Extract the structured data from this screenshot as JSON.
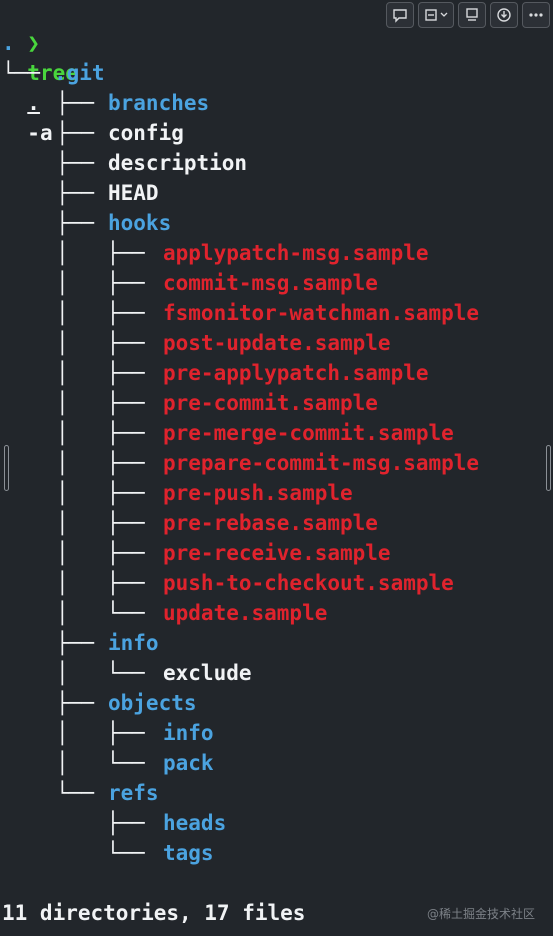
{
  "prompt": {
    "chevron": "❯",
    "command": "tree",
    "args_dot": ".",
    "args_flag": "-a"
  },
  "toolbar": {
    "buttons": [
      {
        "icon": "comment-icon"
      },
      {
        "icon": "align-icon",
        "has_dropdown": true
      },
      {
        "icon": "monitor-icon"
      },
      {
        "icon": "download-icon"
      },
      {
        "icon": "more-icon"
      }
    ]
  },
  "tree": {
    "root": ".",
    "git": ".git",
    "branches": "branches",
    "config": "config",
    "description": "description",
    "head": "HEAD",
    "hooks": "hooks",
    "hook_files": [
      "applypatch-msg.sample",
      "commit-msg.sample",
      "fsmonitor-watchman.sample",
      "post-update.sample",
      "pre-applypatch.sample",
      "pre-commit.sample",
      "pre-merge-commit.sample",
      "prepare-commit-msg.sample",
      "pre-push.sample",
      "pre-rebase.sample",
      "pre-receive.sample",
      "push-to-checkout.sample",
      "update.sample"
    ],
    "info": "info",
    "exclude": "exclude",
    "objects": "objects",
    "objects_info": "info",
    "objects_pack": "pack",
    "refs": "refs",
    "heads": "heads",
    "tags": "tags"
  },
  "summary": "11 directories, 17 files",
  "watermark": "@稀土掘金技术社区",
  "colors": {
    "background": "#22262b",
    "directory": "#4ba3e0",
    "file": "#f1f3f5",
    "sample": "#e0232d",
    "prompt": "#49d63d"
  }
}
